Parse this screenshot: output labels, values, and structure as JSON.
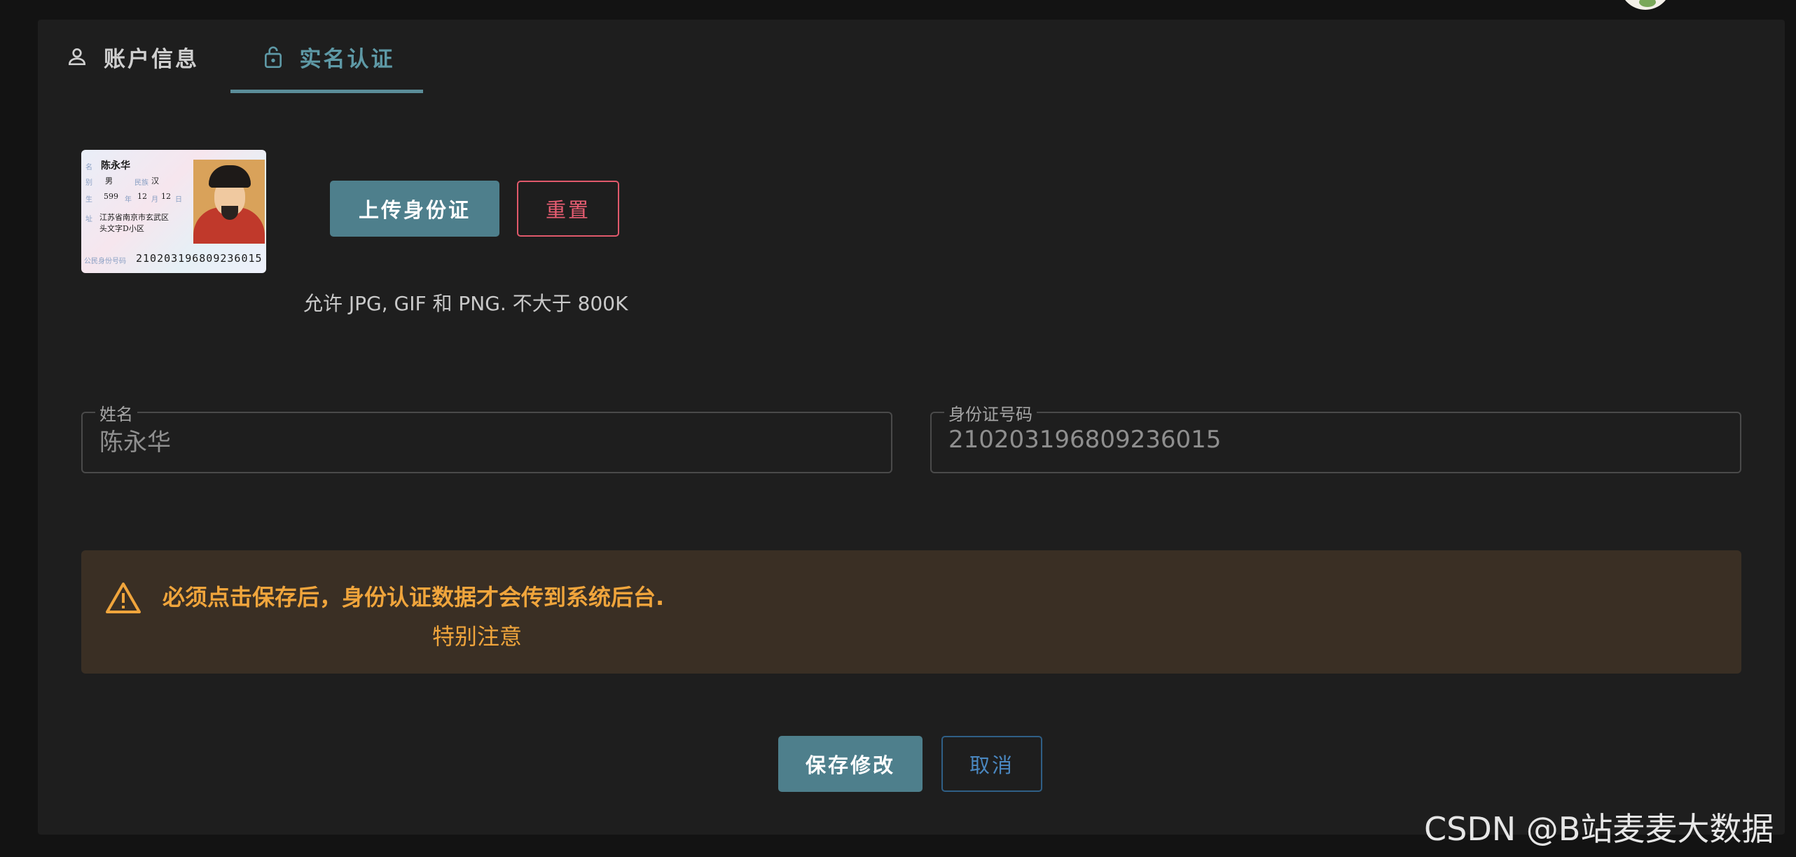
{
  "tabs": [
    {
      "label": "账户信息",
      "icon": "user-icon",
      "active": false
    },
    {
      "label": "实名认证",
      "icon": "lock-open-icon",
      "active": true
    }
  ],
  "id_card": {
    "name": "陈永华",
    "sex": "男",
    "ethnicity": "汉",
    "birth_year": "599",
    "birth_month": "12",
    "birth_day": "12",
    "address_line1": "江苏省南京市玄武区",
    "address_line2": "头文字D小区",
    "number": "210203196809236015"
  },
  "upload": {
    "upload_label": "上传身份证",
    "reset_label": "重置",
    "hint": "允许 JPG, GIF 和 PNG. 不大于 800K"
  },
  "form": {
    "name_label": "姓名",
    "name_value": "陈永华",
    "id_label": "身份证号码",
    "id_value": "210203196809236015"
  },
  "alert": {
    "message": "必须点击保存后，身份认证数据才会传到系统后台.",
    "note": "特别注意"
  },
  "actions": {
    "save_label": "保存修改",
    "cancel_label": "取消"
  },
  "watermark": "CSDN @B站麦麦大数据",
  "colors": {
    "accent": "#4e7f8c",
    "active_tab": "#5e99a6",
    "danger": "#e85d72",
    "warning": "#f0a53c",
    "warning_bg": "#3a2f24",
    "cancel": "#4a87c0"
  }
}
